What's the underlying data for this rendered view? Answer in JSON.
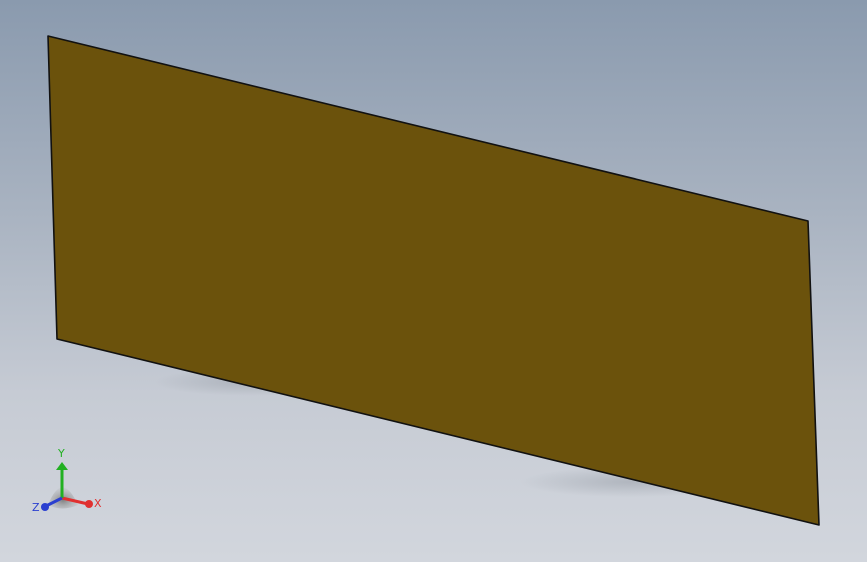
{
  "scene": {
    "background_top": "#8a9aae",
    "background_bottom": "#d2d6dd",
    "part_color": "#6b520c",
    "edge_color": "#111111"
  },
  "triad": {
    "x_label": "X",
    "y_label": "Y",
    "z_label": "Z",
    "x_color": "#e03030",
    "y_color": "#22b022",
    "z_color": "#2a3fd0"
  }
}
